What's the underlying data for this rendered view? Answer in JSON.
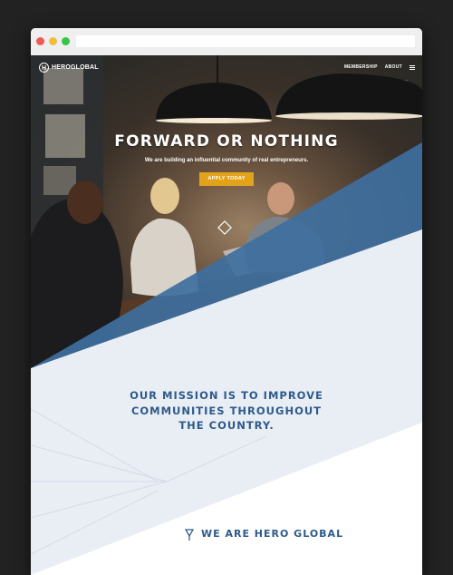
{
  "brand": {
    "name": "HEROGLOBAL",
    "mark": "H"
  },
  "nav": {
    "links": [
      "MEMBERSHIP",
      "ABOUT"
    ],
    "menu_icon": "hamburger-icon"
  },
  "hero": {
    "title": "FORWARD OR NOTHING",
    "subtitle": "We are building an influential community of real entrepreneurs.",
    "cta": "APPLY TODAY"
  },
  "mission": {
    "lines": [
      "OUR MISSION IS TO IMPROVE",
      "COMMUNITIES THROUGHOUT",
      "THE COUNTRY."
    ]
  },
  "about": {
    "heading": "WE ARE HERO GLOBAL"
  },
  "colors": {
    "accent_blue": "#3e6f9e",
    "heading_blue": "#2e5a8a",
    "cta_yellow": "#e2a31b",
    "light_panel": "#e9eef5"
  }
}
